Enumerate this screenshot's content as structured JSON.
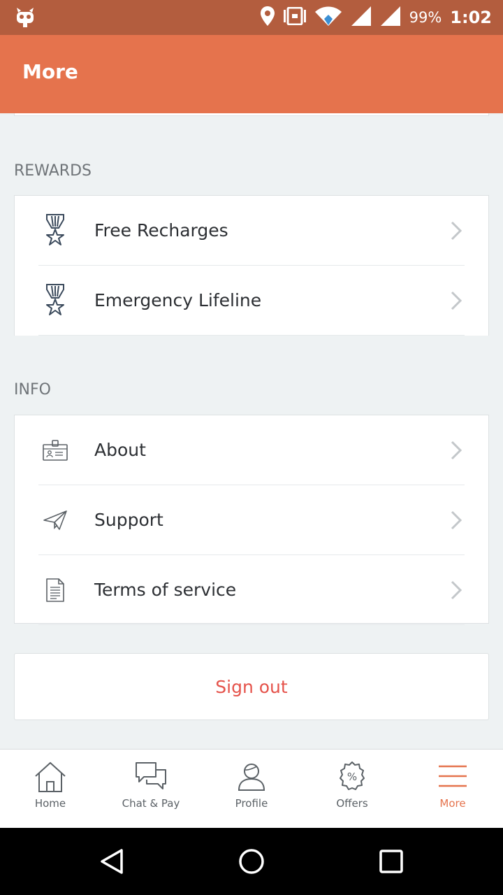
{
  "status_bar": {
    "battery": "99%",
    "time": "1:02"
  },
  "app_bar": {
    "title": "More"
  },
  "rewards": {
    "header": "REWARDS",
    "items": [
      {
        "label": "Free Recharges",
        "icon": "medal-star-icon"
      },
      {
        "label": "Emergency Lifeline",
        "icon": "medal-star-icon"
      }
    ]
  },
  "info": {
    "header": "INFO",
    "items": [
      {
        "label": "About",
        "icon": "id-card-icon"
      },
      {
        "label": "Support",
        "icon": "paper-plane-icon"
      },
      {
        "label": "Terms of service",
        "icon": "document-icon"
      }
    ]
  },
  "sign_out": {
    "label": "Sign out",
    "color": "#e5534b"
  },
  "bottom_nav": {
    "items": [
      {
        "label": "Home",
        "icon": "home-icon"
      },
      {
        "label": "Chat & Pay",
        "icon": "chat-bubbles-icon"
      },
      {
        "label": "Profile",
        "icon": "profile-icon"
      },
      {
        "label": "Offers",
        "icon": "percent-badge-icon"
      },
      {
        "label": "More",
        "icon": "hamburger-menu-icon",
        "active": true
      }
    ],
    "active_color": "#e5734d"
  },
  "colors": {
    "status_bar": "#b35d3e",
    "app_bar": "#e5734d",
    "background": "#eef2f3"
  }
}
